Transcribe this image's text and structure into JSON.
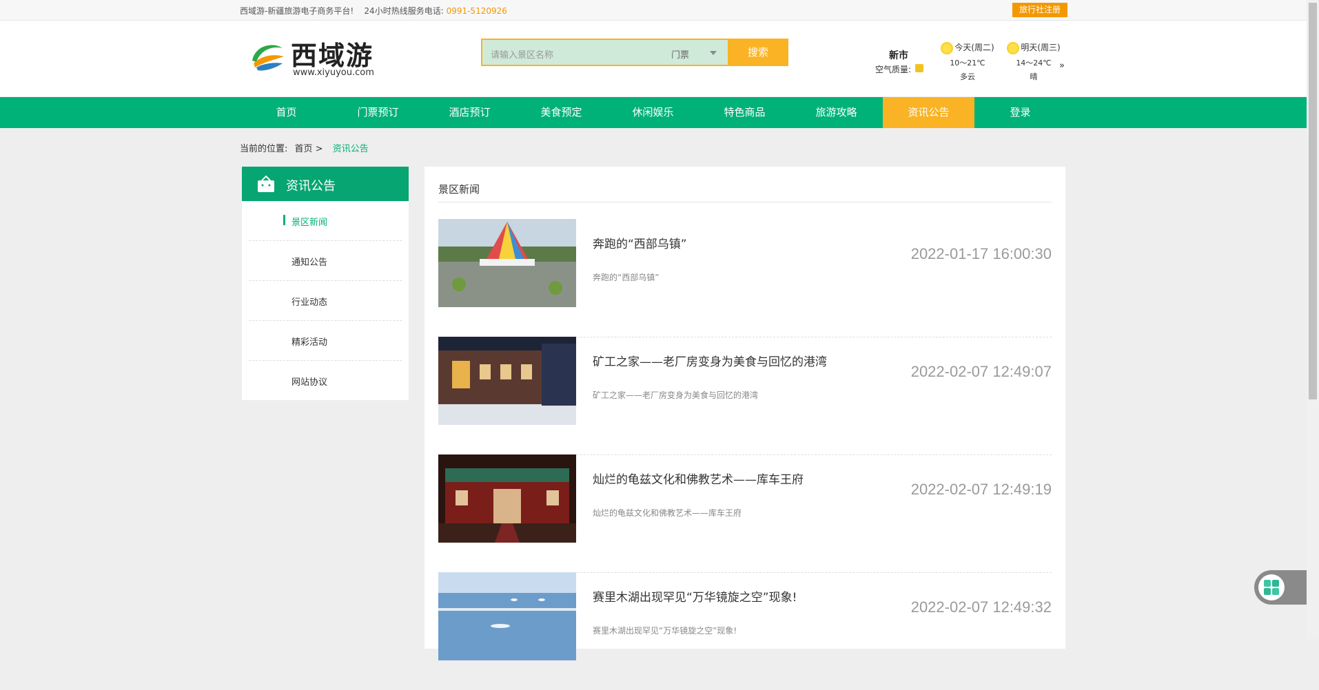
{
  "topbar": {
    "slogan": "西域游-新疆旅游电子商务平台!",
    "hotline_label": "24小时热线服务电话: ",
    "hotline_number": "0991-5120926",
    "register_label": "旅行社注册"
  },
  "logo": {
    "cn": "西域游",
    "en": "www.xiyuyou.com"
  },
  "search": {
    "placeholder": "请输入景区名称",
    "category": "门票",
    "button": "搜索"
  },
  "weather": {
    "city": "新市",
    "air_quality_label": "空气质量:",
    "today": {
      "label": "今天(周二)",
      "temp": "10～21℃",
      "desc": "多云"
    },
    "tomorrow": {
      "label": "明天(周三)",
      "temp": "14～24℃",
      "desc": "晴"
    },
    "more": "»"
  },
  "nav": [
    {
      "label": "首页"
    },
    {
      "label": "门票预订"
    },
    {
      "label": "酒店预订"
    },
    {
      "label": "美食预定"
    },
    {
      "label": "休闲娱乐"
    },
    {
      "label": "特色商品"
    },
    {
      "label": "旅游攻略"
    },
    {
      "label": "资讯公告"
    },
    {
      "label": "登录"
    }
  ],
  "breadcrumb": {
    "prefix": "当前的位置:",
    "home": "首页 >",
    "current": "资讯公告"
  },
  "sidebar": {
    "title": "资讯公告",
    "items": [
      {
        "label": "景区新闻"
      },
      {
        "label": "通知公告"
      },
      {
        "label": "行业动态"
      },
      {
        "label": "精彩活动"
      },
      {
        "label": "网站协议"
      }
    ]
  },
  "main": {
    "section_title": "景区新闻",
    "news": [
      {
        "title": "奔跑的“西部乌镇”",
        "summary": "奔跑的“西部乌镇”",
        "datetime": "2022-01-17 16:00:30"
      },
      {
        "title": "矿工之家——老厂房变身为美食与回忆的港湾",
        "summary": "矿工之家——老厂房变身为美食与回忆的港湾",
        "datetime": "2022-02-07 12:49:07"
      },
      {
        "title": "灿烂的龟兹文化和佛教艺术——库车王府",
        "summary": "灿烂的龟兹文化和佛教艺术——库车王府",
        "datetime": "2022-02-07 12:49:19"
      },
      {
        "title": "赛里木湖出现罕见“万华镜旋之空”现象!",
        "summary": "赛里木湖出现罕见“万华镜旋之空”现象!",
        "datetime": "2022-02-07 12:49:32"
      }
    ]
  },
  "colors": {
    "brand_green": "#00b178",
    "accent_orange": "#f9b324"
  }
}
